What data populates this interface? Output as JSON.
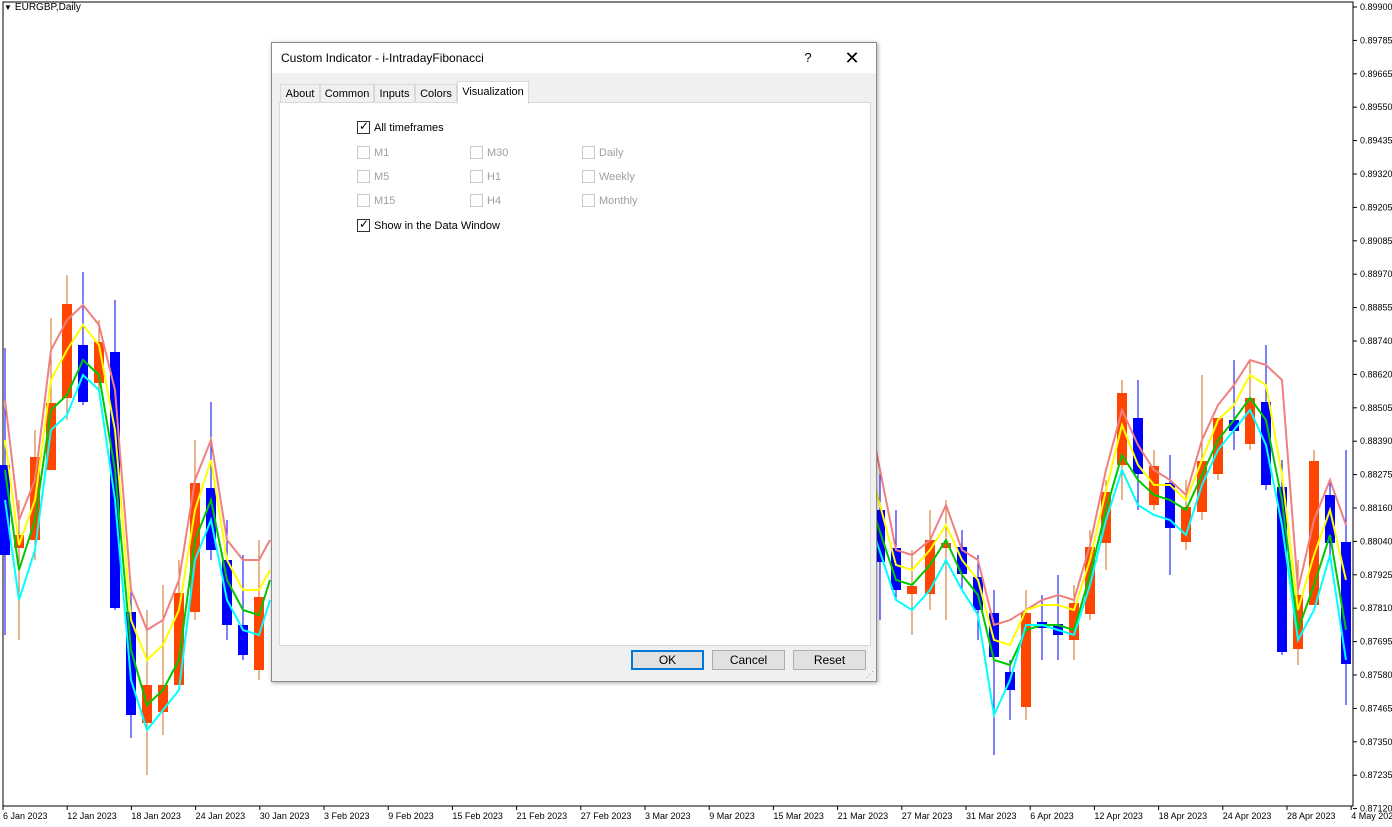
{
  "chart": {
    "symbol_label": "EURGBP,Daily",
    "price_labels": [
      "0.89900",
      "0.89785",
      "0.89665",
      "0.89550",
      "0.89435",
      "0.89320",
      "0.89205",
      "0.89085",
      "0.88970",
      "0.88855",
      "0.88740",
      "0.88620",
      "0.88505",
      "0.88390",
      "0.88275",
      "0.88160",
      "0.88040",
      "0.87925",
      "0.87810",
      "0.87695",
      "0.87580",
      "0.87465",
      "0.87350",
      "0.87235",
      "0.87120"
    ],
    "date_labels": [
      "6 Jan 2023",
      "12 Jan 2023",
      "18 Jan 2023",
      "24 Jan 2023",
      "30 Jan 2023",
      "3 Feb 2023",
      "9 Feb 2023",
      "15 Feb 2023",
      "21 Feb 2023",
      "27 Feb 2023",
      "3 Mar 2023",
      "9 Mar 2023",
      "15 Mar 2023",
      "21 Mar 2023",
      "27 Mar 2023",
      "31 Mar 2023",
      "6 Apr 2023",
      "12 Apr 2023",
      "18 Apr 2023",
      "24 Apr 2023",
      "28 Apr 2023",
      "4 May 202"
    ],
    "colors": {
      "bull": "#ff4500",
      "bear": "#0000ff",
      "wick_bull": "#d2691e",
      "wick_bear": "#0000ff",
      "line_salmon": "#f08080",
      "line_yellow": "#ffff00",
      "line_green": "#00c800",
      "line_cyan": "#00ffff"
    }
  },
  "dialog": {
    "title": "Custom Indicator - i-IntradayFibonacci",
    "help": "?",
    "close": "✕",
    "tabs": [
      "About",
      "Common",
      "Inputs",
      "Colors",
      "Visualization"
    ],
    "active_tab": "Visualization",
    "all_timeframes": {
      "label": "All timeframes",
      "checked": true
    },
    "timeframes": [
      {
        "label": "M1",
        "checked": false
      },
      {
        "label": "M30",
        "checked": false
      },
      {
        "label": "Daily",
        "checked": false
      },
      {
        "label": "M5",
        "checked": false
      },
      {
        "label": "H1",
        "checked": false
      },
      {
        "label": "Weekly",
        "checked": false
      },
      {
        "label": "M15",
        "checked": false
      },
      {
        "label": "H4",
        "checked": false
      },
      {
        "label": "Monthly",
        "checked": false
      }
    ],
    "show_data_window": {
      "label": "Show in the Data Window",
      "checked": true
    },
    "ok": "OK",
    "cancel": "Cancel",
    "reset": "Reset"
  }
}
